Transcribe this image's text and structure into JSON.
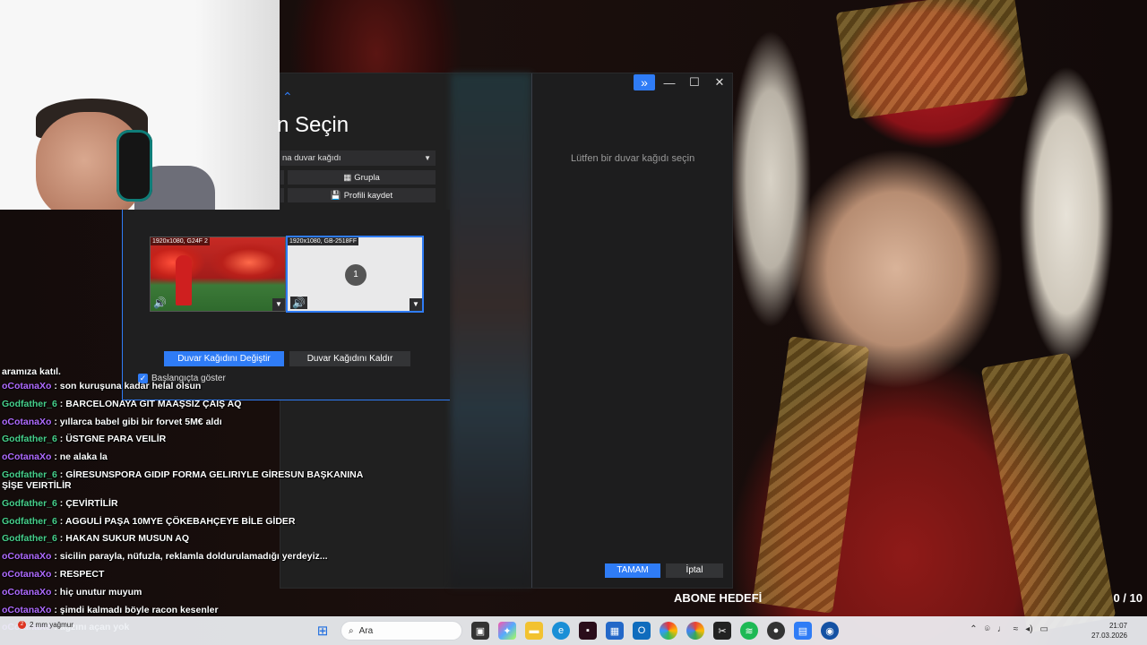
{
  "app": {
    "title": "n Seçin",
    "dropdown_value": "na duvar kağıdı",
    "group_label": "Grupla",
    "save_profile_label": "Profili kaydet",
    "hint": "Lütfen bir duvar kağıdı seçin",
    "ok_label": "TAMAM",
    "cancel_label": "İptal"
  },
  "picker": {
    "thumb1_label": "1920x1080, G24F 2",
    "thumb2_label": "1920x1080, GB-2518FF",
    "thumb2_number": "1",
    "change_label": "Duvar Kağıdını Değiştir",
    "remove_label": "Duvar Kağıdını Kaldır",
    "startup_label": "Başlangıçta göster",
    "startup_checked": true
  },
  "chat": {
    "first_partial": "aramıza katıl.",
    "messages": [
      {
        "user": "oCotanaXo",
        "text": "son kuruşuna kadar helal olsun",
        "color": "purple"
      },
      {
        "user": "Godfather_6",
        "text": "BARCELONAYA GIT MAAŞSIZ ÇAIŞ AQ",
        "color": "green"
      },
      {
        "user": "oCotanaXo",
        "text": "yıllarca babel gibi bir forvet 5M€ aldı",
        "color": "purple"
      },
      {
        "user": "Godfather_6",
        "text": "ÜSTGNE PARA VEILİR",
        "color": "green"
      },
      {
        "user": "oCotanaXo",
        "text": "ne alaka la",
        "color": "purple"
      },
      {
        "user": "Godfather_6",
        "text": "GİRESUNSPORA GIDIP FORMA GELIRIYLE GİRESUN BAŞKANINA",
        "color": "green",
        "cont": "ŞİŞE VEIRTİLİR"
      },
      {
        "user": "Godfather_6",
        "text": "ÇEVİRTİLİR",
        "color": "green"
      },
      {
        "user": "Godfather_6",
        "text": "AGGULİ PAŞA 10MYE ÇÖKEBAHÇEYE BİLE GİDER",
        "color": "green"
      },
      {
        "user": "Godfather_6",
        "text": "HAKAN SUKUR MUSUN AQ",
        "color": "green"
      },
      {
        "user": "oCotanaXo",
        "text": "sicilin parayla, nüfuzla, reklamla doldurulamadığı yerdeyiz...",
        "color": "purple"
      },
      {
        "user": "oCotanaXo",
        "text": "RESPECT",
        "color": "purple"
      },
      {
        "user": "oCotanaXo",
        "text": "hiç unutur muyum",
        "color": "purple"
      },
      {
        "user": "oCotanaXo",
        "text": "şimdi kalmadı böyle racon kesenler",
        "color": "purple"
      },
      {
        "user": "oCotanaXo",
        "text": "ağzını açan yok",
        "color": "purple"
      }
    ]
  },
  "goal": {
    "label": "ABONE HEDEFİ",
    "count": "0 / 10"
  },
  "taskbar": {
    "weather_badge": "2",
    "weather_text": "2 mm yağmur",
    "search_placeholder": "Ara",
    "time": "21:07",
    "date": "27.03.2026"
  },
  "colors": {
    "accent": "#2f7cf6",
    "chat_purple": "#b06bff",
    "chat_green": "#48d18c"
  }
}
